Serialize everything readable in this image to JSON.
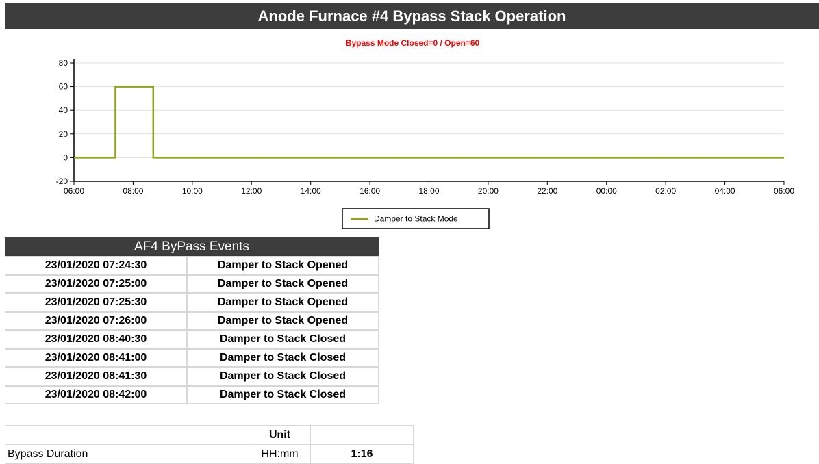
{
  "page": {
    "title": "Anode Furnace #4 Bypass Stack Operation"
  },
  "chart_data": {
    "type": "line",
    "title": "Bypass Mode Closed=0 / Open=60",
    "title_color": "#ff0000",
    "xlabel": "",
    "ylabel": "",
    "ylim": [
      -20,
      80
    ],
    "yticks": [
      "-20",
      "0",
      "20",
      "40",
      "60",
      "80"
    ],
    "xticks": [
      "06:00",
      "08:00",
      "10:00",
      "12:00",
      "14:00",
      "16:00",
      "18:00",
      "20:00",
      "22:00",
      "00:00",
      "02:00",
      "04:00",
      "06:00"
    ],
    "xrange_hours": [
      0,
      24
    ],
    "grid": true,
    "legend_position": "bottom-center",
    "series": [
      {
        "name": "Damper to Stack Mode",
        "color": "#8fa31a",
        "points": [
          {
            "t": "06:00",
            "y": 0
          },
          {
            "t": "07:24",
            "y": 0
          },
          {
            "t": "07:24",
            "y": 60
          },
          {
            "t": "08:41",
            "y": 60
          },
          {
            "t": "08:41",
            "y": 0
          },
          {
            "t": "06:00",
            "y": 0
          }
        ],
        "hours": [
          0,
          1.4,
          1.4,
          2.68,
          2.68,
          24
        ],
        "values": [
          0,
          0,
          60,
          60,
          0,
          0
        ]
      }
    ]
  },
  "events": {
    "header": "AF4 ByPass Events",
    "rows": [
      {
        "time": "23/01/2020 07:24:30",
        "event": "Damper to Stack Opened"
      },
      {
        "time": "23/01/2020 07:25:00",
        "event": "Damper to Stack Opened"
      },
      {
        "time": "23/01/2020 07:25:30",
        "event": "Damper to Stack Opened"
      },
      {
        "time": "23/01/2020 07:26:00",
        "event": "Damper to Stack Opened"
      },
      {
        "time": "23/01/2020 08:40:30",
        "event": "Damper to Stack Closed"
      },
      {
        "time": "23/01/2020 08:41:00",
        "event": "Damper to Stack Closed"
      },
      {
        "time": "23/01/2020 08:41:30",
        "event": "Damper to Stack Closed"
      },
      {
        "time": "23/01/2020 08:42:00",
        "event": "Damper to Stack Closed"
      }
    ]
  },
  "summary": {
    "header_unit": "Unit",
    "rows": [
      {
        "name": "Bypass Duration",
        "unit": "HH:mm",
        "value": "1:16"
      }
    ]
  }
}
